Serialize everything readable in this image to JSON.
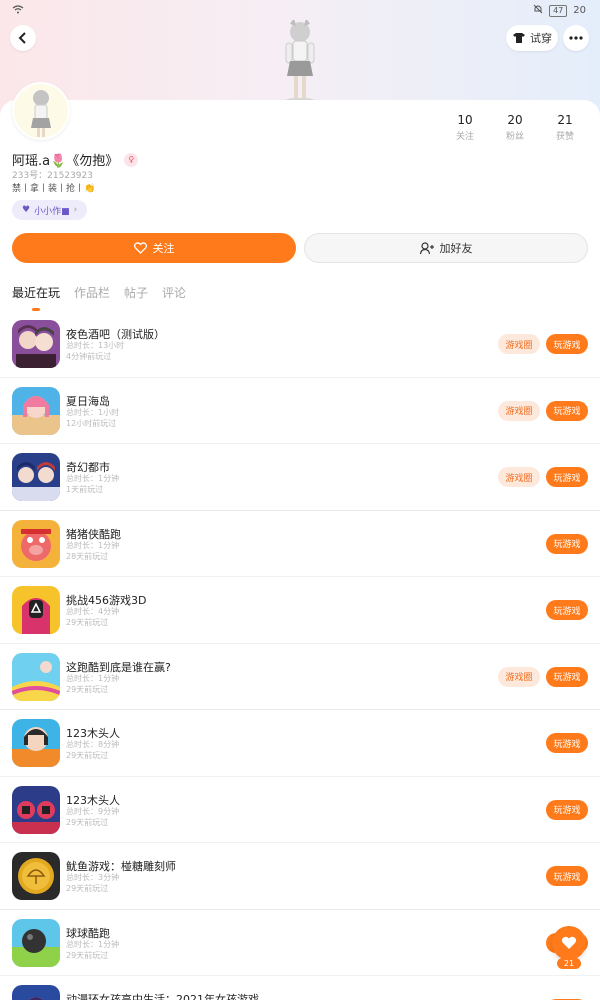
{
  "status_bar": {
    "battery": "47",
    "time": "20"
  },
  "header": {
    "try_on_label": "试穿"
  },
  "profile": {
    "name": "阿瑶.a🌷《勿抱》",
    "id_line": "233号：21523923",
    "bio": "禁丨拿丨装丨抢丨👏",
    "tag_label": "小小作■",
    "stats": [
      {
        "value": "10",
        "label": "关注"
      },
      {
        "value": "20",
        "label": "粉丝"
      },
      {
        "value": "21",
        "label": "获赞"
      }
    ]
  },
  "actions": {
    "follow_label": "关注",
    "add_friend_label": "加好友"
  },
  "tabs": [
    "最近在玩",
    "作品栏",
    "帖子",
    "评论"
  ],
  "game_buttons": {
    "circle_label": "游戏圈",
    "play_label": "玩游戏"
  },
  "games": [
    {
      "title": "夜色酒吧（测试版）",
      "meta1": "总时长：13小时",
      "meta2": "4分钟前玩过",
      "has_circle": true,
      "icon": "anime-bar"
    },
    {
      "title": "夏日海岛",
      "meta1": "总时长：1小时",
      "meta2": "12小时前玩过",
      "has_circle": true,
      "icon": "summer-island"
    },
    {
      "title": "奇幻都市",
      "meta1": "总时长：1分钟",
      "meta2": "1天前玩过",
      "has_circle": true,
      "icon": "fantasy-city"
    },
    {
      "title": "猪猪侠酷跑",
      "meta1": "总时长：1分钟",
      "meta2": "28天前玩过",
      "has_circle": false,
      "icon": "pig-hero"
    },
    {
      "title": "挑战456游戏3D",
      "meta1": "总时长：4分钟",
      "meta2": "29天前玩过",
      "has_circle": false,
      "icon": "squid-guard"
    },
    {
      "title": "这跑酷到底是谁在赢?",
      "meta1": "总时长：1分钟",
      "meta2": "29天前玩过",
      "has_circle": true,
      "icon": "parkour"
    },
    {
      "title": "123木头人",
      "meta1": "总时长：8分钟",
      "meta2": "29天前玩过",
      "has_circle": false,
      "icon": "doll"
    },
    {
      "title": "123木头人",
      "meta1": "总时长：9分钟",
      "meta2": "29天前玩过",
      "has_circle": false,
      "icon": "red-guards"
    },
    {
      "title": "鱿鱼游戏：椪糖雕刻师",
      "meta1": "总时长：3分钟",
      "meta2": "29天前玩过",
      "has_circle": false,
      "icon": "dalgona"
    },
    {
      "title": "球球酷跑",
      "meta1": "总时长：1分钟",
      "meta2": "29天前玩过",
      "has_circle": false,
      "icon": "ball-run"
    },
    {
      "title": "动漫环女孩高中生活：2021年女孩游戏",
      "meta1": "",
      "meta2": "",
      "has_circle": false,
      "icon": "anime-girl"
    }
  ],
  "floating": {
    "like_count": "21"
  },
  "colors": {
    "accent": "#ff7a1a",
    "accent_light": "#fde8dc"
  }
}
